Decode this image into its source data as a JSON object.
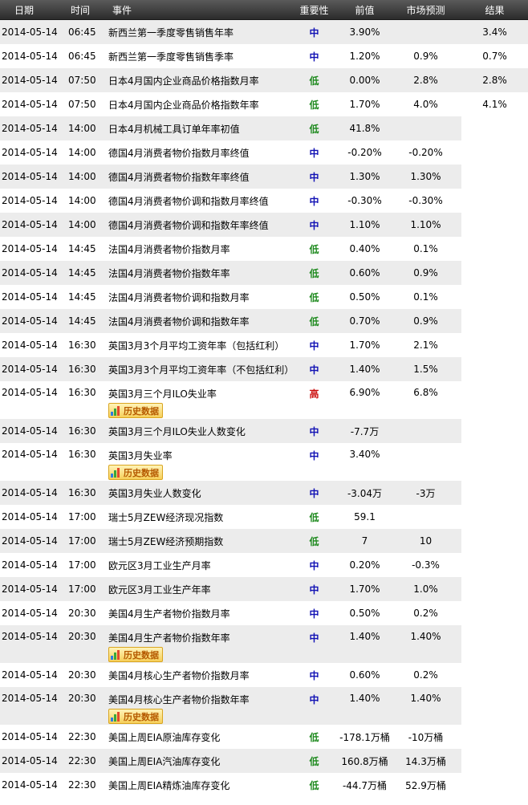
{
  "header": {
    "date": "日期",
    "time": "时间",
    "event": "事件",
    "importance": "重要性",
    "previous": "前值",
    "forecast": "市场预测",
    "result": "结果"
  },
  "history_label": "历史数据",
  "colors": {
    "mid": "#1010b4",
    "low": "#1f8a1f",
    "high": "#cc1010",
    "row_shade": "#ececec"
  },
  "rows": [
    {
      "date": "2014-05-14",
      "time": "06:45",
      "event": "新西兰第一季度零售销售年率",
      "importance": "中",
      "level": "mid",
      "previous": "3.90%",
      "forecast": "",
      "result": "3.4%",
      "history": false
    },
    {
      "date": "2014-05-14",
      "time": "06:45",
      "event": "新西兰第一季度零售销售季率",
      "importance": "中",
      "level": "mid",
      "previous": "1.20%",
      "forecast": "0.9%",
      "result": "0.7%",
      "history": false
    },
    {
      "date": "2014-05-14",
      "time": "07:50",
      "event": "日本4月国内企业商品价格指数月率",
      "importance": "低",
      "level": "low",
      "previous": "0.00%",
      "forecast": "2.8%",
      "result": "2.8%",
      "history": false
    },
    {
      "date": "2014-05-14",
      "time": "07:50",
      "event": "日本4月国内企业商品价格指数年率",
      "importance": "低",
      "level": "low",
      "previous": "1.70%",
      "forecast": "4.0%",
      "result": "4.1%",
      "history": false
    },
    {
      "date": "2014-05-14",
      "time": "14:00",
      "event": "日本4月机械工具订单年率初值",
      "importance": "低",
      "level": "low",
      "previous": "41.8%",
      "forecast": "",
      "result": "",
      "history": false
    },
    {
      "date": "2014-05-14",
      "time": "14:00",
      "event": "德国4月消费者物价指数月率终值",
      "importance": "中",
      "level": "mid",
      "previous": "-0.20%",
      "forecast": "-0.20%",
      "result": "",
      "history": false
    },
    {
      "date": "2014-05-14",
      "time": "14:00",
      "event": "德国4月消费者物价指数年率终值",
      "importance": "中",
      "level": "mid",
      "previous": "1.30%",
      "forecast": "1.30%",
      "result": "",
      "history": false
    },
    {
      "date": "2014-05-14",
      "time": "14:00",
      "event": "德国4月消费者物价调和指数月率终值",
      "importance": "中",
      "level": "mid",
      "previous": "-0.30%",
      "forecast": "-0.30%",
      "result": "",
      "history": false
    },
    {
      "date": "2014-05-14",
      "time": "14:00",
      "event": "德国4月消费者物价调和指数年率终值",
      "importance": "中",
      "level": "mid",
      "previous": "1.10%",
      "forecast": "1.10%",
      "result": "",
      "history": false
    },
    {
      "date": "2014-05-14",
      "time": "14:45",
      "event": "法国4月消费者物价指数月率",
      "importance": "低",
      "level": "low",
      "previous": "0.40%",
      "forecast": "0.1%",
      "result": "",
      "history": false
    },
    {
      "date": "2014-05-14",
      "time": "14:45",
      "event": "法国4月消费者物价指数年率",
      "importance": "低",
      "level": "low",
      "previous": "0.60%",
      "forecast": "0.9%",
      "result": "",
      "history": false
    },
    {
      "date": "2014-05-14",
      "time": "14:45",
      "event": "法国4月消费者物价调和指数月率",
      "importance": "低",
      "level": "low",
      "previous": "0.50%",
      "forecast": "0.1%",
      "result": "",
      "history": false
    },
    {
      "date": "2014-05-14",
      "time": "14:45",
      "event": "法国4月消费者物价调和指数年率",
      "importance": "低",
      "level": "low",
      "previous": "0.70%",
      "forecast": "0.9%",
      "result": "",
      "history": false
    },
    {
      "date": "2014-05-14",
      "time": "16:30",
      "event": "英国3月3个月平均工资年率（包括红利）",
      "importance": "中",
      "level": "mid",
      "previous": "1.70%",
      "forecast": "2.1%",
      "result": "",
      "history": false
    },
    {
      "date": "2014-05-14",
      "time": "16:30",
      "event": "英国3月3个月平均工资年率（不包括红利）",
      "importance": "中",
      "level": "mid",
      "previous": "1.40%",
      "forecast": "1.5%",
      "result": "",
      "history": false
    },
    {
      "date": "2014-05-14",
      "time": "16:30",
      "event": "英国3月三个月ILO失业率",
      "importance": "高",
      "level": "high",
      "previous": "6.90%",
      "forecast": "6.8%",
      "result": "",
      "history": true
    },
    {
      "date": "2014-05-14",
      "time": "16:30",
      "event": "英国3月三个月ILO失业人数变化",
      "importance": "中",
      "level": "mid",
      "previous": "-7.7万",
      "forecast": "",
      "result": "",
      "history": false
    },
    {
      "date": "2014-05-14",
      "time": "16:30",
      "event": "英国3月失业率",
      "importance": "中",
      "level": "mid",
      "previous": "3.40%",
      "forecast": "",
      "result": "",
      "history": true
    },
    {
      "date": "2014-05-14",
      "time": "16:30",
      "event": "英国3月失业人数变化",
      "importance": "中",
      "level": "mid",
      "previous": "-3.04万",
      "forecast": "-3万",
      "result": "",
      "history": false
    },
    {
      "date": "2014-05-14",
      "time": "17:00",
      "event": "瑞士5月ZEW经济现况指数",
      "importance": "低",
      "level": "low",
      "previous": "59.1",
      "forecast": "",
      "result": "",
      "history": false
    },
    {
      "date": "2014-05-14",
      "time": "17:00",
      "event": "瑞士5月ZEW经济预期指数",
      "importance": "低",
      "level": "low",
      "previous": "7",
      "forecast": "10",
      "result": "",
      "history": false
    },
    {
      "date": "2014-05-14",
      "time": "17:00",
      "event": "欧元区3月工业生产月率",
      "importance": "中",
      "level": "mid",
      "previous": "0.20%",
      "forecast": "-0.3%",
      "result": "",
      "history": false
    },
    {
      "date": "2014-05-14",
      "time": "17:00",
      "event": "欧元区3月工业生产年率",
      "importance": "中",
      "level": "mid",
      "previous": "1.70%",
      "forecast": "1.0%",
      "result": "",
      "history": false
    },
    {
      "date": "2014-05-14",
      "time": "20:30",
      "event": "美国4月生产者物价指数月率",
      "importance": "中",
      "level": "mid",
      "previous": "0.50%",
      "forecast": "0.2%",
      "result": "",
      "history": false
    },
    {
      "date": "2014-05-14",
      "time": "20:30",
      "event": "美国4月生产者物价指数年率",
      "importance": "中",
      "level": "mid",
      "previous": "1.40%",
      "forecast": "1.40%",
      "result": "",
      "history": true
    },
    {
      "date": "2014-05-14",
      "time": "20:30",
      "event": "美国4月核心生产者物价指数月率",
      "importance": "中",
      "level": "mid",
      "previous": "0.60%",
      "forecast": "0.2%",
      "result": "",
      "history": false
    },
    {
      "date": "2014-05-14",
      "time": "20:30",
      "event": "美国4月核心生产者物价指数年率",
      "importance": "中",
      "level": "mid",
      "previous": "1.40%",
      "forecast": "1.40%",
      "result": "",
      "history": true
    },
    {
      "date": "2014-05-14",
      "time": "22:30",
      "event": "美国上周EIA原油库存变化",
      "importance": "低",
      "level": "low",
      "previous": "-178.1万桶",
      "forecast": "-10万桶",
      "result": "",
      "history": false
    },
    {
      "date": "2014-05-14",
      "time": "22:30",
      "event": "美国上周EIA汽油库存变化",
      "importance": "低",
      "level": "low",
      "previous": "160.8万桶",
      "forecast": "14.3万桶",
      "result": "",
      "history": false
    },
    {
      "date": "2014-05-14",
      "time": "22:30",
      "event": "美国上周EIA精炼油库存变化",
      "importance": "低",
      "level": "low",
      "previous": "-44.7万桶",
      "forecast": "52.9万桶",
      "result": "",
      "history": false
    }
  ]
}
